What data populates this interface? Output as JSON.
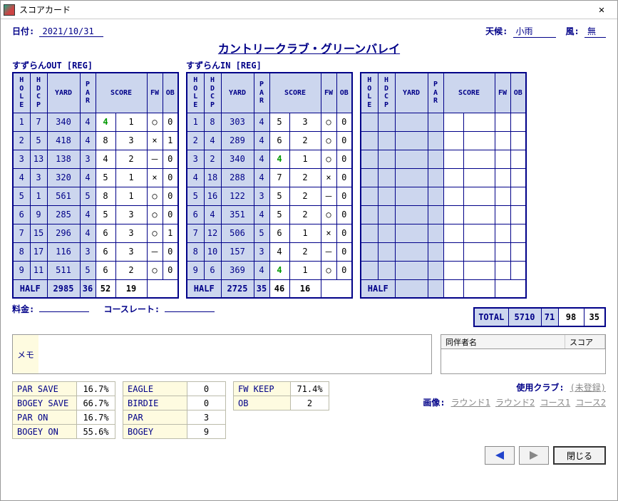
{
  "window": {
    "title": "スコアカード"
  },
  "header": {
    "date_label": "日付:",
    "date_value": "2021/10/31",
    "weather_label": "天候:",
    "weather_value": "小雨",
    "wind_label": "風:",
    "wind_value": "無"
  },
  "course_title": "カントリークラブ・グリーンバレイ",
  "columns": {
    "hole": "H\nO\nL\nE",
    "hdcp": "H\nD\nC\nP",
    "yard": "YARD",
    "par": "P\nA\nR",
    "score": "SCORE",
    "fw": "FW",
    "ob": "OB"
  },
  "cards": [
    {
      "label": "すずらんOUT [REG]",
      "rows": [
        {
          "hole": "1",
          "hdcp": "7",
          "yard": "340",
          "par": "4",
          "score": "4",
          "putt": "1",
          "mark": "○",
          "ob": "0",
          "good": true
        },
        {
          "hole": "2",
          "hdcp": "5",
          "yard": "418",
          "par": "4",
          "score": "8",
          "putt": "3",
          "mark": "×",
          "ob": "1"
        },
        {
          "hole": "3",
          "hdcp": "13",
          "yard": "138",
          "par": "3",
          "score": "4",
          "putt": "2",
          "mark": "－",
          "ob": "0"
        },
        {
          "hole": "4",
          "hdcp": "3",
          "yard": "320",
          "par": "4",
          "score": "5",
          "putt": "1",
          "mark": "×",
          "ob": "0"
        },
        {
          "hole": "5",
          "hdcp": "1",
          "yard": "561",
          "par": "5",
          "score": "8",
          "putt": "1",
          "mark": "○",
          "ob": "0"
        },
        {
          "hole": "6",
          "hdcp": "9",
          "yard": "285",
          "par": "4",
          "score": "5",
          "putt": "3",
          "mark": "○",
          "ob": "0"
        },
        {
          "hole": "7",
          "hdcp": "15",
          "yard": "296",
          "par": "4",
          "score": "6",
          "putt": "3",
          "mark": "○",
          "ob": "1"
        },
        {
          "hole": "8",
          "hdcp": "17",
          "yard": "116",
          "par": "3",
          "score": "6",
          "putt": "3",
          "mark": "－",
          "ob": "0"
        },
        {
          "hole": "9",
          "hdcp": "11",
          "yard": "511",
          "par": "5",
          "score": "6",
          "putt": "2",
          "mark": "○",
          "ob": "0"
        }
      ],
      "half": {
        "label": "HALF",
        "yard": "2985",
        "par": "36",
        "score": "52",
        "putt": "19"
      }
    },
    {
      "label": "すずらんIN [REG]",
      "rows": [
        {
          "hole": "1",
          "hdcp": "8",
          "yard": "303",
          "par": "4",
          "score": "5",
          "putt": "3",
          "mark": "○",
          "ob": "0"
        },
        {
          "hole": "2",
          "hdcp": "4",
          "yard": "289",
          "par": "4",
          "score": "6",
          "putt": "2",
          "mark": "○",
          "ob": "0"
        },
        {
          "hole": "3",
          "hdcp": "2",
          "yard": "340",
          "par": "4",
          "score": "4",
          "putt": "1",
          "mark": "○",
          "ob": "0",
          "good": true
        },
        {
          "hole": "4",
          "hdcp": "18",
          "yard": "288",
          "par": "4",
          "score": "7",
          "putt": "2",
          "mark": "×",
          "ob": "0"
        },
        {
          "hole": "5",
          "hdcp": "16",
          "yard": "122",
          "par": "3",
          "score": "5",
          "putt": "2",
          "mark": "－",
          "ob": "0"
        },
        {
          "hole": "6",
          "hdcp": "4",
          "yard": "351",
          "par": "4",
          "score": "5",
          "putt": "2",
          "mark": "○",
          "ob": "0"
        },
        {
          "hole": "7",
          "hdcp": "12",
          "yard": "506",
          "par": "5",
          "score": "6",
          "putt": "1",
          "mark": "×",
          "ob": "0"
        },
        {
          "hole": "8",
          "hdcp": "10",
          "yard": "157",
          "par": "3",
          "score": "4",
          "putt": "2",
          "mark": "－",
          "ob": "0"
        },
        {
          "hole": "9",
          "hdcp": "6",
          "yard": "369",
          "par": "4",
          "score": "4",
          "putt": "1",
          "mark": "○",
          "ob": "0",
          "good": true
        }
      ],
      "half": {
        "label": "HALF",
        "yard": "2725",
        "par": "35",
        "score": "46",
        "putt": "16"
      }
    },
    {
      "label": "",
      "rows": [
        {
          "hole": "",
          "hdcp": "",
          "yard": "",
          "par": "",
          "score": "",
          "putt": "",
          "mark": "",
          "ob": ""
        },
        {
          "hole": "",
          "hdcp": "",
          "yard": "",
          "par": "",
          "score": "",
          "putt": "",
          "mark": "",
          "ob": ""
        },
        {
          "hole": "",
          "hdcp": "",
          "yard": "",
          "par": "",
          "score": "",
          "putt": "",
          "mark": "",
          "ob": ""
        },
        {
          "hole": "",
          "hdcp": "",
          "yard": "",
          "par": "",
          "score": "",
          "putt": "",
          "mark": "",
          "ob": ""
        },
        {
          "hole": "",
          "hdcp": "",
          "yard": "",
          "par": "",
          "score": "",
          "putt": "",
          "mark": "",
          "ob": ""
        },
        {
          "hole": "",
          "hdcp": "",
          "yard": "",
          "par": "",
          "score": "",
          "putt": "",
          "mark": "",
          "ob": ""
        },
        {
          "hole": "",
          "hdcp": "",
          "yard": "",
          "par": "",
          "score": "",
          "putt": "",
          "mark": "",
          "ob": ""
        },
        {
          "hole": "",
          "hdcp": "",
          "yard": "",
          "par": "",
          "score": "",
          "putt": "",
          "mark": "",
          "ob": ""
        },
        {
          "hole": "",
          "hdcp": "",
          "yard": "",
          "par": "",
          "score": "",
          "putt": "",
          "mark": "",
          "ob": ""
        }
      ],
      "half": {
        "label": "HALF",
        "yard": "",
        "par": "",
        "score": "",
        "putt": ""
      }
    }
  ],
  "totals": {
    "label": "TOTAL",
    "yard": "5710",
    "par": "71",
    "score": "98",
    "putt": "35"
  },
  "fee_label": "料金:",
  "courserate_label": "コースレート:",
  "memo_label": "メモ",
  "companion": {
    "name_header": "同伴者名",
    "score_header": "スコア"
  },
  "stats1": [
    {
      "label": "PAR SAVE",
      "value": "16.7%"
    },
    {
      "label": "BOGEY SAVE",
      "value": "66.7%"
    },
    {
      "label": "PAR ON",
      "value": "16.7%"
    },
    {
      "label": "BOGEY ON",
      "value": "55.6%"
    }
  ],
  "stats2": [
    {
      "label": "EAGLE",
      "value": "0"
    },
    {
      "label": "BIRDIE",
      "value": "0"
    },
    {
      "label": "PAR",
      "value": "3"
    },
    {
      "label": "BOGEY",
      "value": "9"
    }
  ],
  "stats3": [
    {
      "label": "FW KEEP",
      "value": "71.4%"
    },
    {
      "label": "OB",
      "value": "2"
    }
  ],
  "clubs": {
    "used_label": "使用クラブ:",
    "used_value": "(未登録)",
    "image_label": "画像:",
    "links": [
      "ラウンド1",
      "ラウンド2",
      "コース1",
      "コース2"
    ]
  },
  "close_button": "閉じる"
}
